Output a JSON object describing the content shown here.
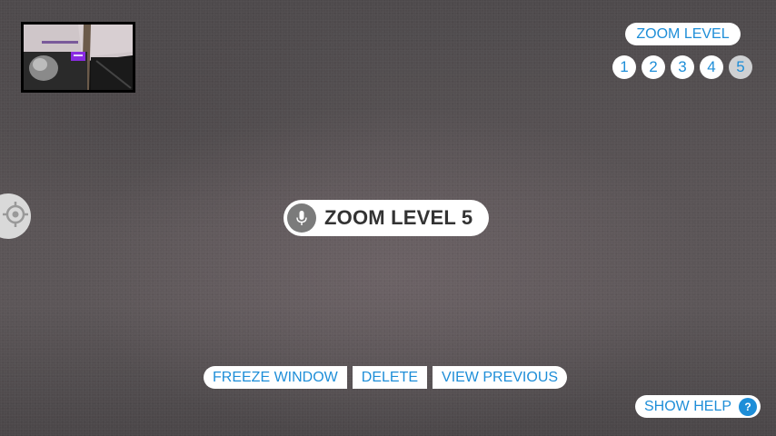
{
  "zoom": {
    "title": "ZOOM LEVEL",
    "levels": [
      "1",
      "2",
      "3",
      "4",
      "5"
    ],
    "current": "5"
  },
  "toast": {
    "icon": "microphone-icon",
    "text": "ZOOM LEVEL 5"
  },
  "commands": {
    "freeze": "FREEZE WINDOW",
    "delete": "DELETE",
    "view_previous": "VIEW PREVIOUS"
  },
  "help": {
    "label": "SHOW HELP",
    "icon_glyph": "?"
  },
  "preview": {
    "icon": "camera-preview-thumbnail"
  },
  "target": {
    "icon": "crosshair-icon"
  },
  "colors": {
    "accent": "#1e8ed8",
    "active_level_bg": "#cfd1d3",
    "mic_bg": "#7b7b7b"
  }
}
